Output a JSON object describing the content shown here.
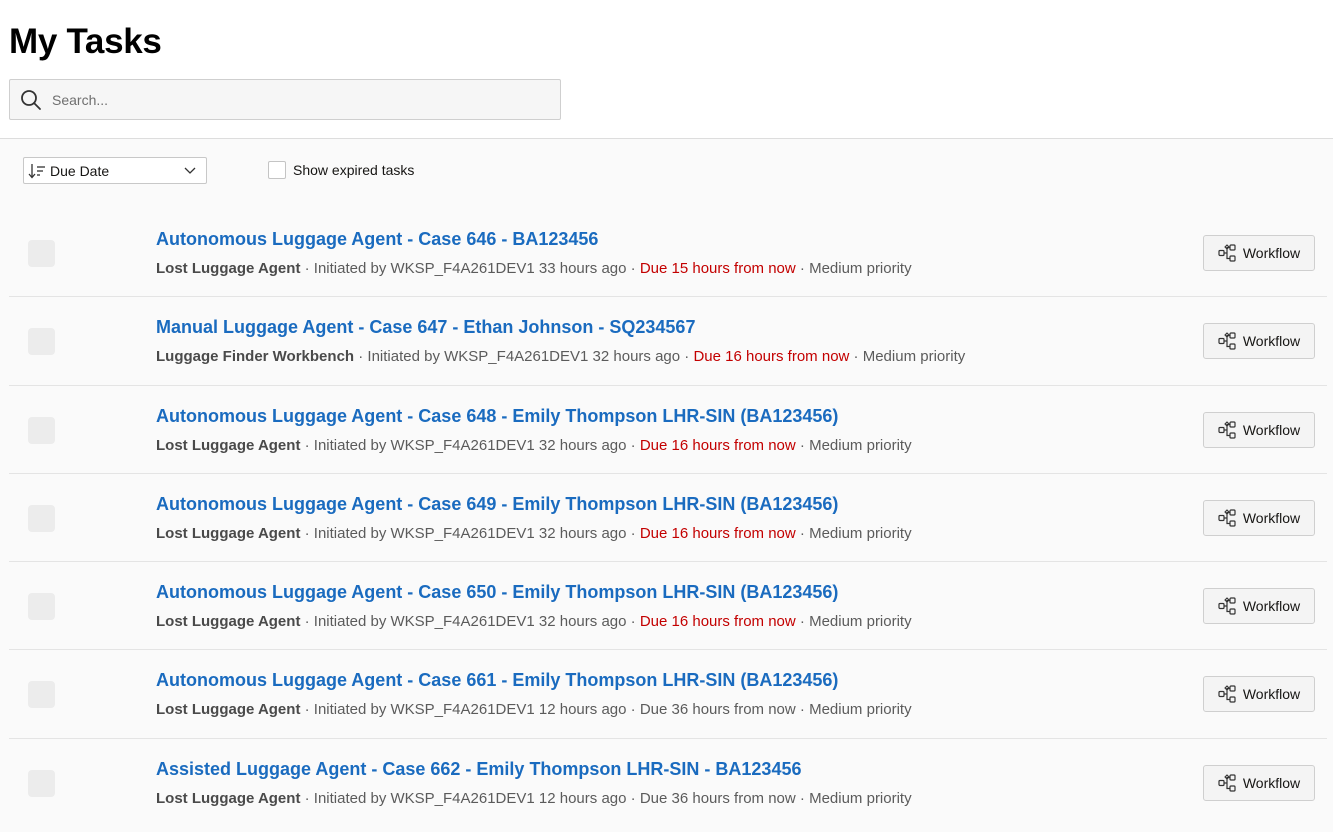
{
  "page": {
    "title": "My Tasks"
  },
  "search": {
    "placeholder": "Search..."
  },
  "toolbar": {
    "sort_label": "Due Date",
    "expired_label": "Show expired tasks"
  },
  "tasks": [
    {
      "title": "Autonomous Luggage Agent - Case 646 - BA123456",
      "app": "Lost Luggage Agent",
      "initiated": "Initiated by WKSP_F4A261DEV1 33 hours ago",
      "due": "Due 15 hours from now",
      "due_overdue_style": true,
      "priority": "Medium priority",
      "button": "Workflow"
    },
    {
      "title": "Manual Luggage Agent - Case 647 - Ethan Johnson - SQ234567",
      "app": "Luggage Finder Workbench",
      "initiated": "Initiated by WKSP_F4A261DEV1 32 hours ago",
      "due": "Due 16 hours from now",
      "due_overdue_style": true,
      "priority": "Medium priority",
      "button": "Workflow"
    },
    {
      "title": "Autonomous Luggage Agent - Case 648 - Emily Thompson LHR-SIN (BA123456)",
      "app": "Lost Luggage Agent",
      "initiated": "Initiated by WKSP_F4A261DEV1 32 hours ago",
      "due": "Due 16 hours from now",
      "due_overdue_style": true,
      "priority": "Medium priority",
      "button": "Workflow"
    },
    {
      "title": "Autonomous Luggage Agent - Case 649 - Emily Thompson LHR-SIN (BA123456)",
      "app": "Lost Luggage Agent",
      "initiated": "Initiated by WKSP_F4A261DEV1 32 hours ago",
      "due": "Due 16 hours from now",
      "due_overdue_style": true,
      "priority": "Medium priority",
      "button": "Workflow"
    },
    {
      "title": "Autonomous Luggage Agent - Case 650 - Emily Thompson LHR-SIN (BA123456)",
      "app": "Lost Luggage Agent",
      "initiated": "Initiated by WKSP_F4A261DEV1 32 hours ago",
      "due": "Due 16 hours from now",
      "due_overdue_style": true,
      "priority": "Medium priority",
      "button": "Workflow"
    },
    {
      "title": "Autonomous Luggage Agent - Case 661 - Emily Thompson LHR-SIN (BA123456)",
      "app": "Lost Luggage Agent",
      "initiated": "Initiated by WKSP_F4A261DEV1 12 hours ago",
      "due": "Due 36 hours from now",
      "due_overdue_style": false,
      "priority": "Medium priority",
      "button": "Workflow"
    },
    {
      "title": "Assisted Luggage Agent - Case 662 - Emily Thompson LHR-SIN - BA123456",
      "app": "Lost Luggage Agent",
      "initiated": "Initiated by WKSP_F4A261DEV1 12 hours ago",
      "due": "Due 36 hours from now",
      "due_overdue_style": false,
      "priority": "Medium priority",
      "button": "Workflow"
    }
  ],
  "colors": {
    "link": "#1a6bbf",
    "due_soon": "#c30000",
    "meta": "#5b5b5b"
  },
  "icons": {
    "search": "search-icon",
    "sort": "sort-descending-icon",
    "chevron": "chevron-down-icon",
    "workflow": "workflow-diagram-icon"
  }
}
